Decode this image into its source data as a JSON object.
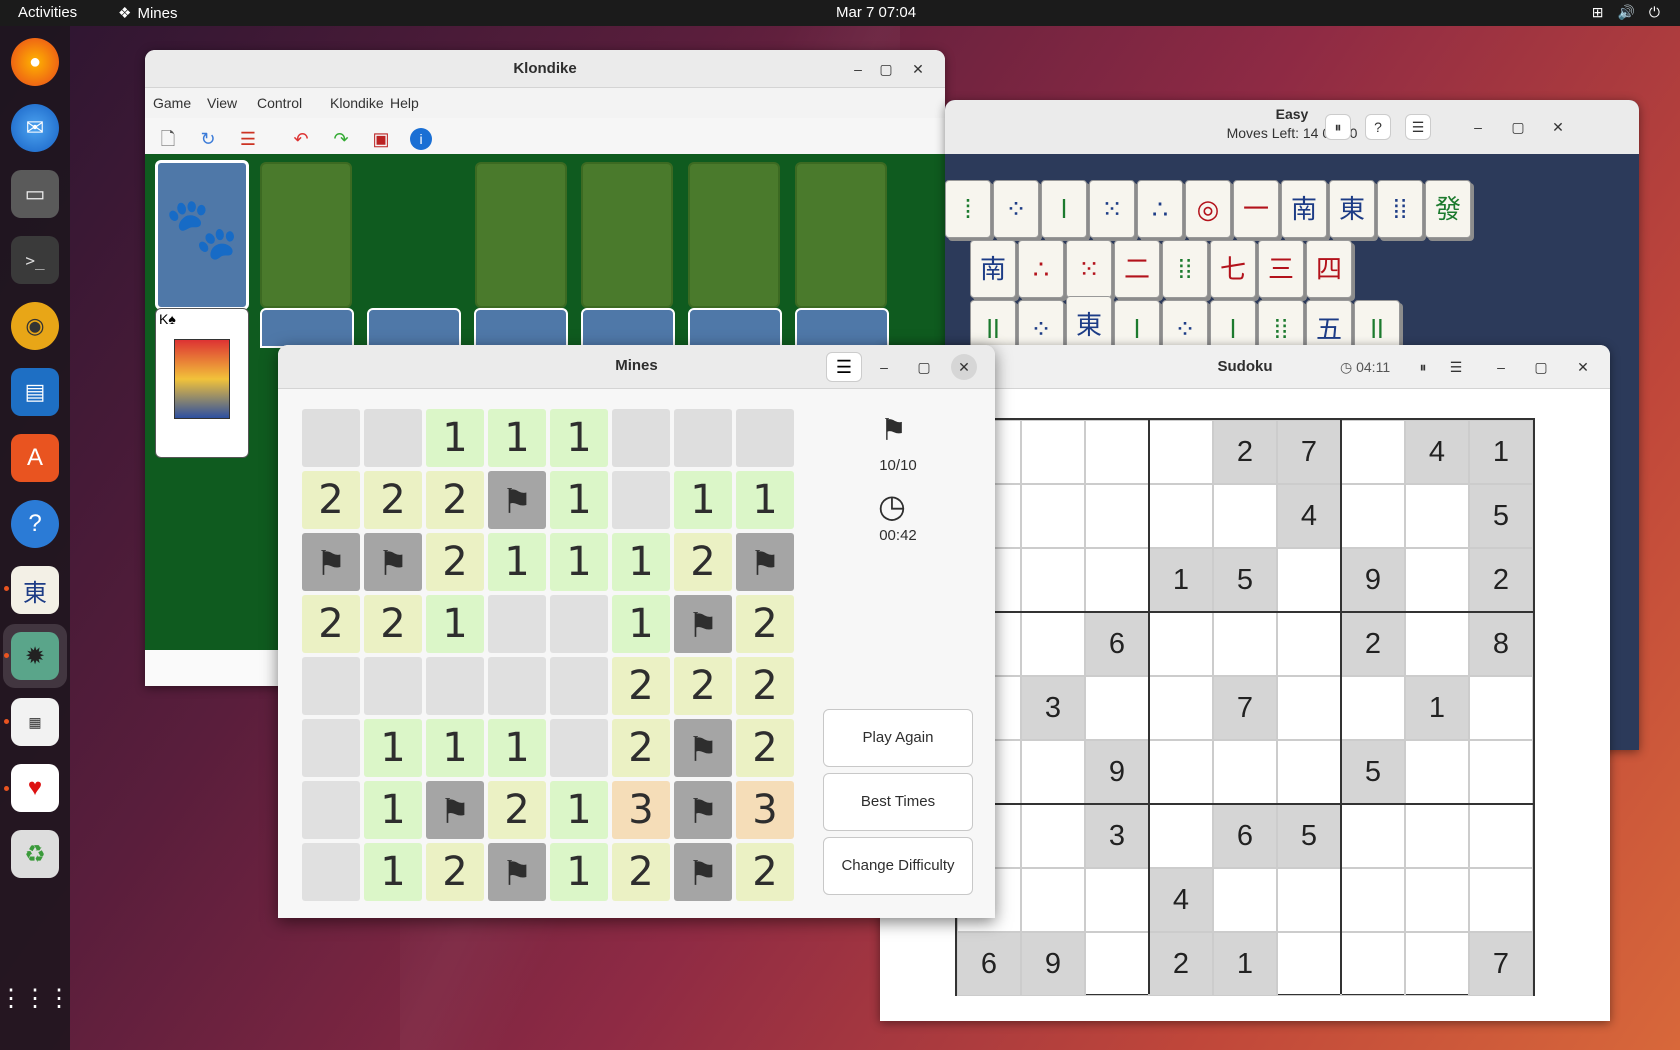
{
  "topbar": {
    "activities": "Activities",
    "app_name": "Mines",
    "clock": "Mar 7  07:04"
  },
  "dock": {
    "items": [
      "firefox-icon",
      "thunderbird-icon",
      "files-icon",
      "terminal-icon",
      "rhythmbox-icon",
      "writer-icon",
      "app-center-icon",
      "help-icon",
      "mahjongg-icon",
      "mines-icon",
      "sudoku-icon",
      "solitaire-icon",
      "trash-icon",
      "show-apps-icon"
    ]
  },
  "klondike": {
    "title": "Klondike",
    "menu": [
      "Game",
      "View",
      "Control",
      "Klondike",
      "Help"
    ]
  },
  "mahjongg": {
    "title": "Easy",
    "status": "Moves Left: 14   00:00"
  },
  "sudoku": {
    "title": "Sudoku",
    "timer": "04:11",
    "cells": [
      [
        "",
        "",
        "",
        "",
        "2",
        "7",
        "",
        "4",
        "1"
      ],
      [
        "",
        "",
        "",
        "",
        "",
        "4",
        "",
        "",
        "5"
      ],
      [
        "",
        "",
        "",
        "1",
        "5",
        "",
        "9",
        "",
        "2"
      ],
      [
        "",
        "",
        "6",
        "",
        "",
        "",
        "2",
        "",
        "8"
      ],
      [
        "",
        "3",
        "",
        "",
        "7",
        "",
        "",
        "1",
        ""
      ],
      [
        "",
        "",
        "9",
        "",
        "",
        "",
        "5",
        "",
        ""
      ],
      [
        "",
        "",
        "3",
        "",
        "6",
        "5",
        "",
        "",
        ""
      ],
      [
        "",
        "",
        "",
        "4",
        "",
        "",
        "",
        "",
        ""
      ],
      [
        "6",
        "9",
        "",
        "2",
        "1",
        "",
        "",
        "",
        "7"
      ]
    ]
  },
  "mines": {
    "title": "Mines",
    "flags": "10/10",
    "time": "00:42",
    "buttons": {
      "play_again": "Play Again",
      "best_times": "Best Times",
      "change_difficulty": "Change Difficulty"
    },
    "board": [
      [
        "U",
        "U",
        "1",
        "1",
        "1",
        "U",
        "U",
        "U"
      ],
      [
        "2",
        "2",
        "2",
        "F",
        "1",
        "E",
        "1",
        "1"
      ],
      [
        "F",
        "F",
        "2",
        "1",
        "1",
        "1",
        "2",
        "F"
      ],
      [
        "2",
        "2",
        "1",
        "E",
        "E",
        "1",
        "F",
        "2"
      ],
      [
        "E",
        "E",
        "E",
        "E",
        "E",
        "2",
        "2",
        "2"
      ],
      [
        "E",
        "1",
        "1",
        "1",
        "E",
        "2",
        "F",
        "2"
      ],
      [
        "E",
        "1",
        "F",
        "2",
        "1",
        "3",
        "F",
        "3"
      ],
      [
        "E",
        "1",
        "2",
        "F",
        "1",
        "2",
        "F",
        "2"
      ]
    ]
  }
}
